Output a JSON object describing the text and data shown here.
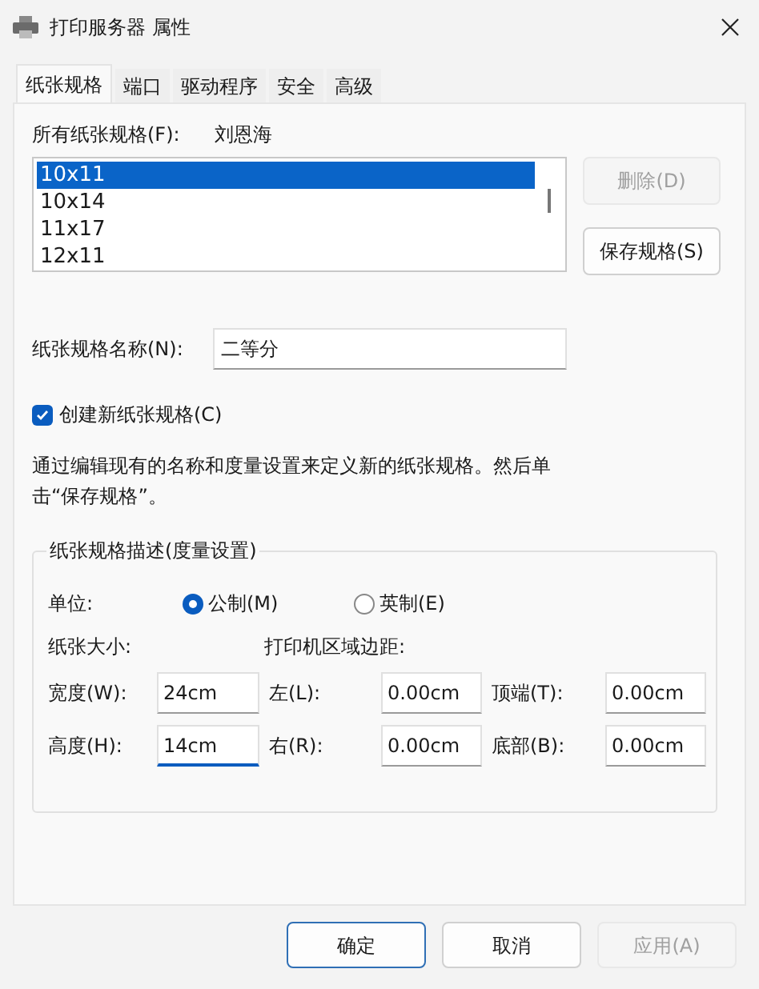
{
  "window": {
    "title": "打印服务器 属性"
  },
  "tabs": [
    {
      "label": "纸张规格",
      "selected": true
    },
    {
      "label": "端口",
      "selected": false
    },
    {
      "label": "驱动程序",
      "selected": false
    },
    {
      "label": "安全",
      "selected": false
    },
    {
      "label": "高级",
      "selected": false
    }
  ],
  "forms_list": {
    "label": "所有纸张规格(F):",
    "server_name": "刘恩海",
    "items": [
      {
        "text": "10x11",
        "selected": true
      },
      {
        "text": "10x14",
        "selected": false
      },
      {
        "text": "11x17",
        "selected": false
      },
      {
        "text": "12x11",
        "selected": false
      }
    ]
  },
  "side_buttons": [
    {
      "label": "删除(D)",
      "disabled": true
    },
    {
      "label": "保存规格(S)",
      "disabled": false
    }
  ],
  "form_name": {
    "label": "纸张规格名称(N):",
    "value": "二等分"
  },
  "create_new": {
    "label": "创建新纸张规格(C)",
    "checked": true
  },
  "description": "通过编辑现有的名称和度量设置来定义新的纸张规格。然后单击“保存规格”。",
  "group": {
    "title": "纸张规格描述(度量设置)",
    "units_label": "单位:",
    "units": [
      {
        "label": "公制(M)",
        "selected": true
      },
      {
        "label": "英制(E)",
        "selected": false
      }
    ],
    "paper_size_label": "纸张大小:",
    "margins_label": "打印机区域边距:",
    "fields": [
      {
        "label": "宽度(W):",
        "value": "24cm",
        "focused": false
      },
      {
        "label": "左(L):",
        "value": "0.00cm",
        "focused": false
      },
      {
        "label": "顶端(T):",
        "value": "0.00cm",
        "focused": false
      },
      {
        "label": "高度(H):",
        "value": "14cm",
        "focused": true
      },
      {
        "label": "右(R):",
        "value": "0.00cm",
        "focused": false
      },
      {
        "label": "底部(B):",
        "value": "0.00cm",
        "focused": false
      }
    ]
  },
  "footer_buttons": [
    {
      "label": "确定",
      "default": true,
      "disabled": false
    },
    {
      "label": "取消",
      "default": false,
      "disabled": false
    },
    {
      "label": "应用(A)",
      "default": false,
      "disabled": true
    }
  ]
}
